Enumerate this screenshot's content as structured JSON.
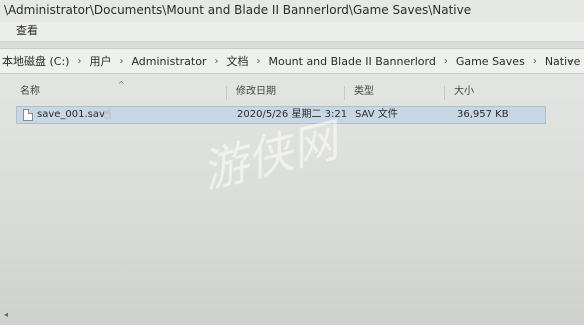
{
  "window": {
    "title": "\\Administrator\\Documents\\Mount and Blade II Bannerlord\\Game Saves\\Native"
  },
  "ribbon": {
    "view_tab": "查看"
  },
  "address": {
    "crumbs": [
      "本地磁盘 (C:)",
      "用户",
      "Administrator",
      "文档",
      "Mount and Blade II Bannerlord",
      "Game Saves",
      "Native"
    ]
  },
  "columns": {
    "name": "名称",
    "modified": "修改日期",
    "type": "类型",
    "size": "大小"
  },
  "files": [
    {
      "name": "save_001.sav",
      "modified": "2020/5/26 星期二 3:21",
      "type": "SAV 文件",
      "size": "36,957 KB"
    }
  ],
  "watermark": "游侠网",
  "icons": {
    "file": "file-icon",
    "chevron": "chevron-down-icon",
    "sort": "sort-up-icon",
    "cursor": "mouse-cursor-icon"
  }
}
